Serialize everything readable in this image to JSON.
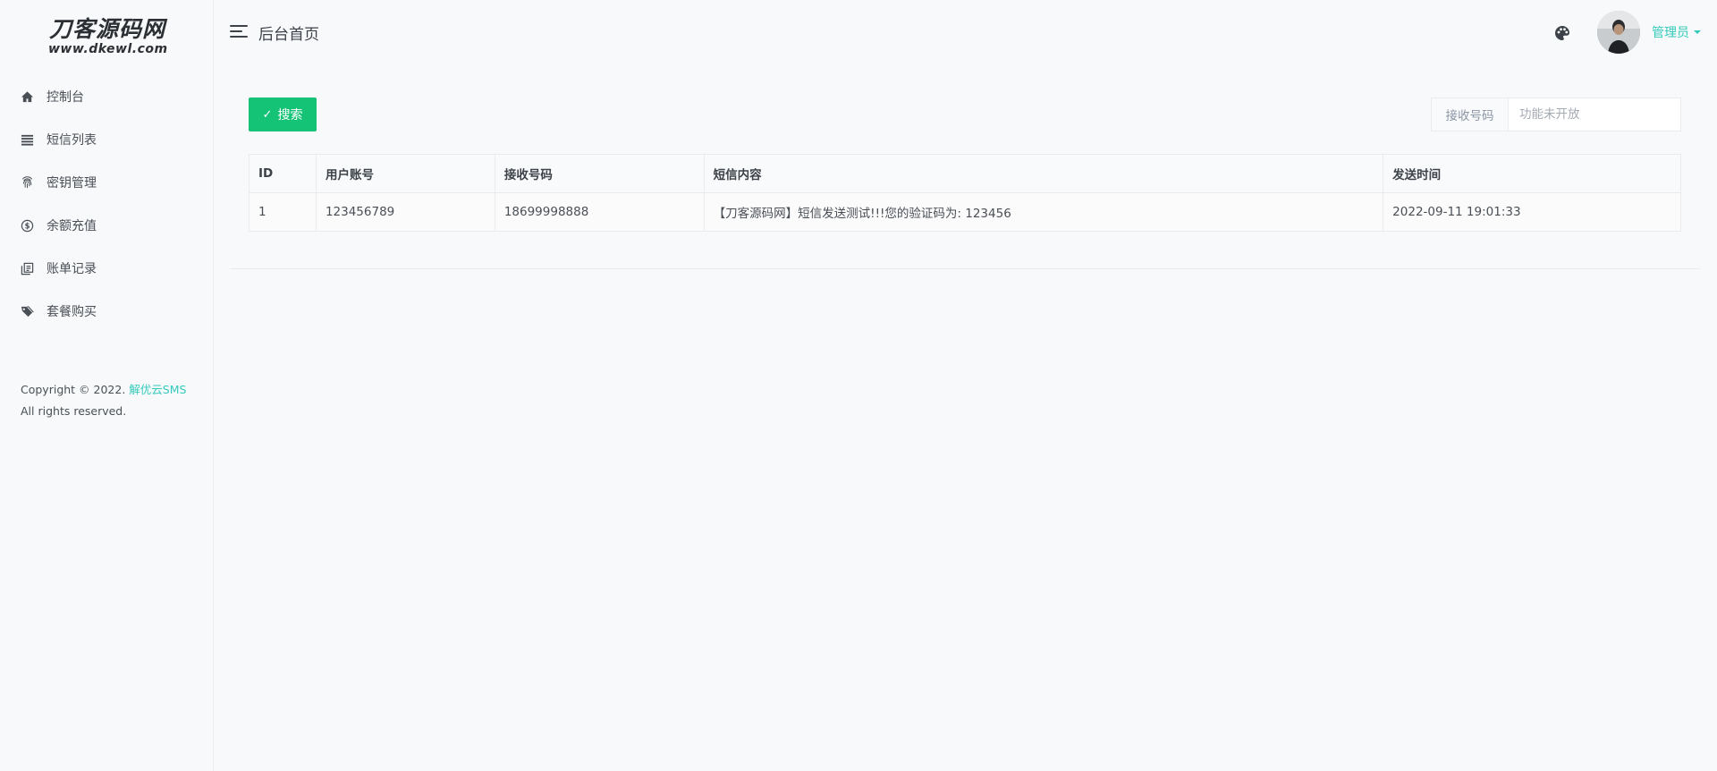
{
  "brand": {
    "title": "刀客源码网",
    "url": "www.dkewl.com"
  },
  "sidebar": {
    "items": [
      {
        "label": "控制台",
        "icon": "home-icon"
      },
      {
        "label": "短信列表",
        "icon": "list-icon"
      },
      {
        "label": "密钥管理",
        "icon": "fingerprint-icon"
      },
      {
        "label": "余额充值",
        "icon": "dollar-circle-icon"
      },
      {
        "label": "账单记录",
        "icon": "copy-documents-icon"
      },
      {
        "label": "套餐购买",
        "icon": "tags-icon"
      }
    ],
    "copyright_prefix": "Copyright © 2022.",
    "copyright_brand": "解优云SMS",
    "copyright_suffix": "All rights reserved."
  },
  "header": {
    "page_title": "后台首页",
    "palette_icon": "palette-icon",
    "user_label": "管理员"
  },
  "toolbar": {
    "search_label": "搜索",
    "filter_label": "接收号码",
    "filter_placeholder": "功能未开放",
    "filter_value": ""
  },
  "table": {
    "columns": [
      "ID",
      "用户账号",
      "接收号码",
      "短信内容",
      "发送时间"
    ],
    "rows": [
      [
        "1",
        "123456789",
        "18699998888",
        "【刀客源码网】短信发送测试!!!您的验证码为: 123456",
        "2022-09-11 19:01:33"
      ]
    ]
  },
  "colors": {
    "accent": "#33cabb",
    "success": "#15c377"
  }
}
